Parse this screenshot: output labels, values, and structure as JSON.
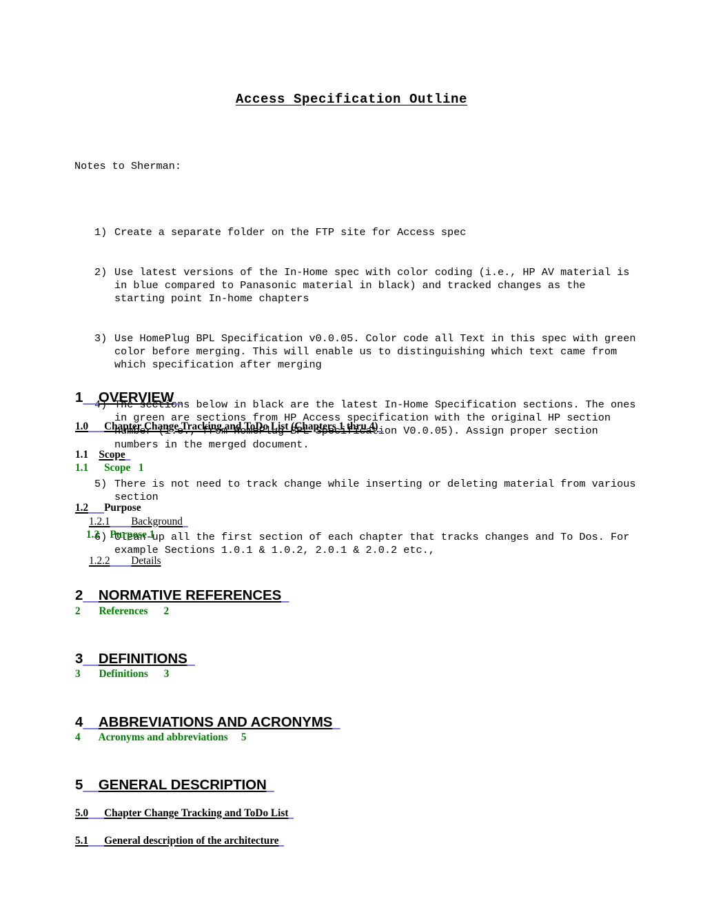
{
  "document": {
    "title": "Access Specification Outline"
  },
  "notes": {
    "intro": "Notes to Sherman:",
    "items": [
      {
        "marker": "1)",
        "text": "Create a separate folder on the FTP site for Access spec"
      },
      {
        "marker": "2)",
        "text": "Use latest versions of the In-Home spec with color coding (i.e., HP AV material is in blue compared to Panasonic material in black) and tracked changes as the starting point In-home chapters"
      },
      {
        "marker": "3)",
        "text": "Use HomePlug BPL Specification v0.0.05. Color code all Text in this spec with green color before merging. This will enable us to distinguishing which text came from which specification after merging"
      },
      {
        "marker": "4)",
        "text": "The sections below in black are the latest In-Home Specification sections. The ones in green are sections from HP Access specification with the original HP section number (i.e., from HomePlug BPL Specification V0.0.05). Assign proper section numbers in the merged document."
      },
      {
        "marker": "5)",
        "text": "There is not need to track change while inserting or deleting material from various section"
      },
      {
        "marker": "6)",
        "text": "Clean-up all the first section of each chapter that tracks changes and To Dos. For example Sections 1.0.1 & 1.0.2, 2.0.1 & 2.0.2 etc.,"
      }
    ]
  },
  "outline": {
    "chapter1": {
      "number": "1",
      "title": "OVERVIEW"
    },
    "s1_0": {
      "number": "1.0",
      "title": "Chapter Change Tracking and ToDo List (Chapters 1 thru 4)"
    },
    "s1_1": {
      "number": "1.1",
      "title": "Scope"
    },
    "g1_1": {
      "number": "1.1",
      "title": "Scope",
      "page": "1"
    },
    "s1_2": {
      "number": "1.2",
      "title": "Purpose"
    },
    "s1_2_1": {
      "number": "1.2.1",
      "title": "Background"
    },
    "g1_2": {
      "number": "1.2",
      "title": "Purpose",
      "page": "1"
    },
    "s1_2_2": {
      "number": "1.2.2",
      "title": "Details"
    },
    "chapter2": {
      "number": "2",
      "title": "NORMATIVE REFERENCES"
    },
    "g2": {
      "number": "2",
      "title": "References",
      "page": "2"
    },
    "chapter3": {
      "number": "3",
      "title": "DEFINITIONS"
    },
    "g3": {
      "number": "3",
      "title": "Definitions",
      "page": "3"
    },
    "chapter4": {
      "number": "4",
      "title": "ABBREVIATIONS AND ACRONYMS"
    },
    "g4": {
      "number": "4",
      "title": "Acronyms and abbreviations",
      "page": "5"
    },
    "chapter5": {
      "number": "5",
      "title": "GENERAL DESCRIPTION"
    },
    "s5_0": {
      "number": "5.0",
      "title": "Chapter Change Tracking and ToDo List"
    },
    "s5_1": {
      "number": "5.1",
      "title": "General description of the architecture"
    }
  },
  "colors": {
    "green_text": "#008000",
    "tab_leader_blue": "#7b7bdd",
    "body_text": "#000000"
  }
}
